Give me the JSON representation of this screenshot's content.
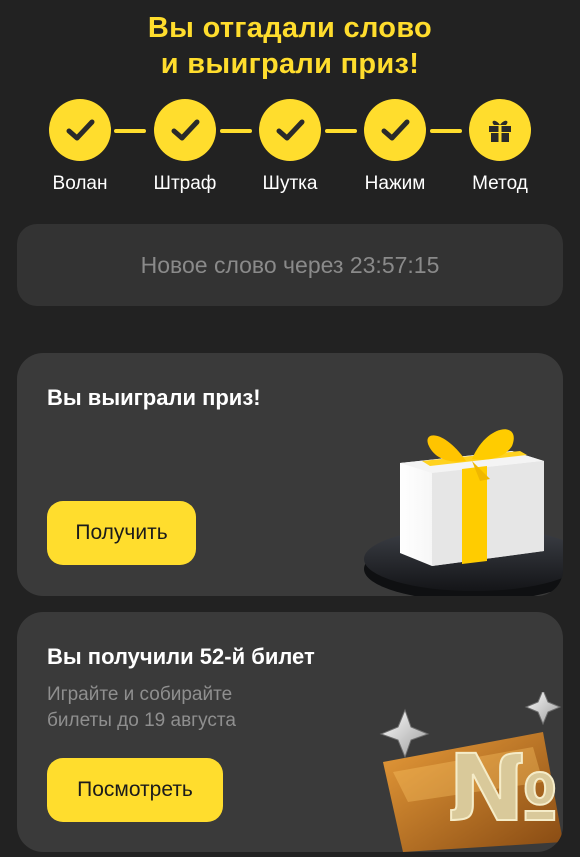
{
  "header": {
    "title_line1": "Вы отгадали слово",
    "title_line2": "и выиграли приз!"
  },
  "steps": [
    {
      "label": "Волан",
      "status": "done",
      "icon": "check-icon"
    },
    {
      "label": "Штраф",
      "status": "done",
      "icon": "check-icon"
    },
    {
      "label": "Шутка",
      "status": "done",
      "icon": "check-icon"
    },
    {
      "label": "Нажим",
      "status": "done",
      "icon": "check-icon"
    },
    {
      "label": "Метод",
      "status": "prize",
      "icon": "gift-icon"
    }
  ],
  "timer": {
    "text": "Новое слово через 23:57:15"
  },
  "prize_card": {
    "title": "Вы выиграли приз!",
    "button": "Получить",
    "image": "gift-box-illustration"
  },
  "ticket_card": {
    "title": "Вы получили 52-й билет",
    "subtitle_line1": "Играйте и собирайте",
    "subtitle_line2": "билеты до 19 августа",
    "button": "Посмотреть",
    "image": "ticket-number-sign-illustration",
    "image_text": "№"
  },
  "colors": {
    "background": "#222222",
    "card": "#3a3a3a",
    "accent": "#ffdd2d",
    "muted_text": "#8a8a8a"
  }
}
